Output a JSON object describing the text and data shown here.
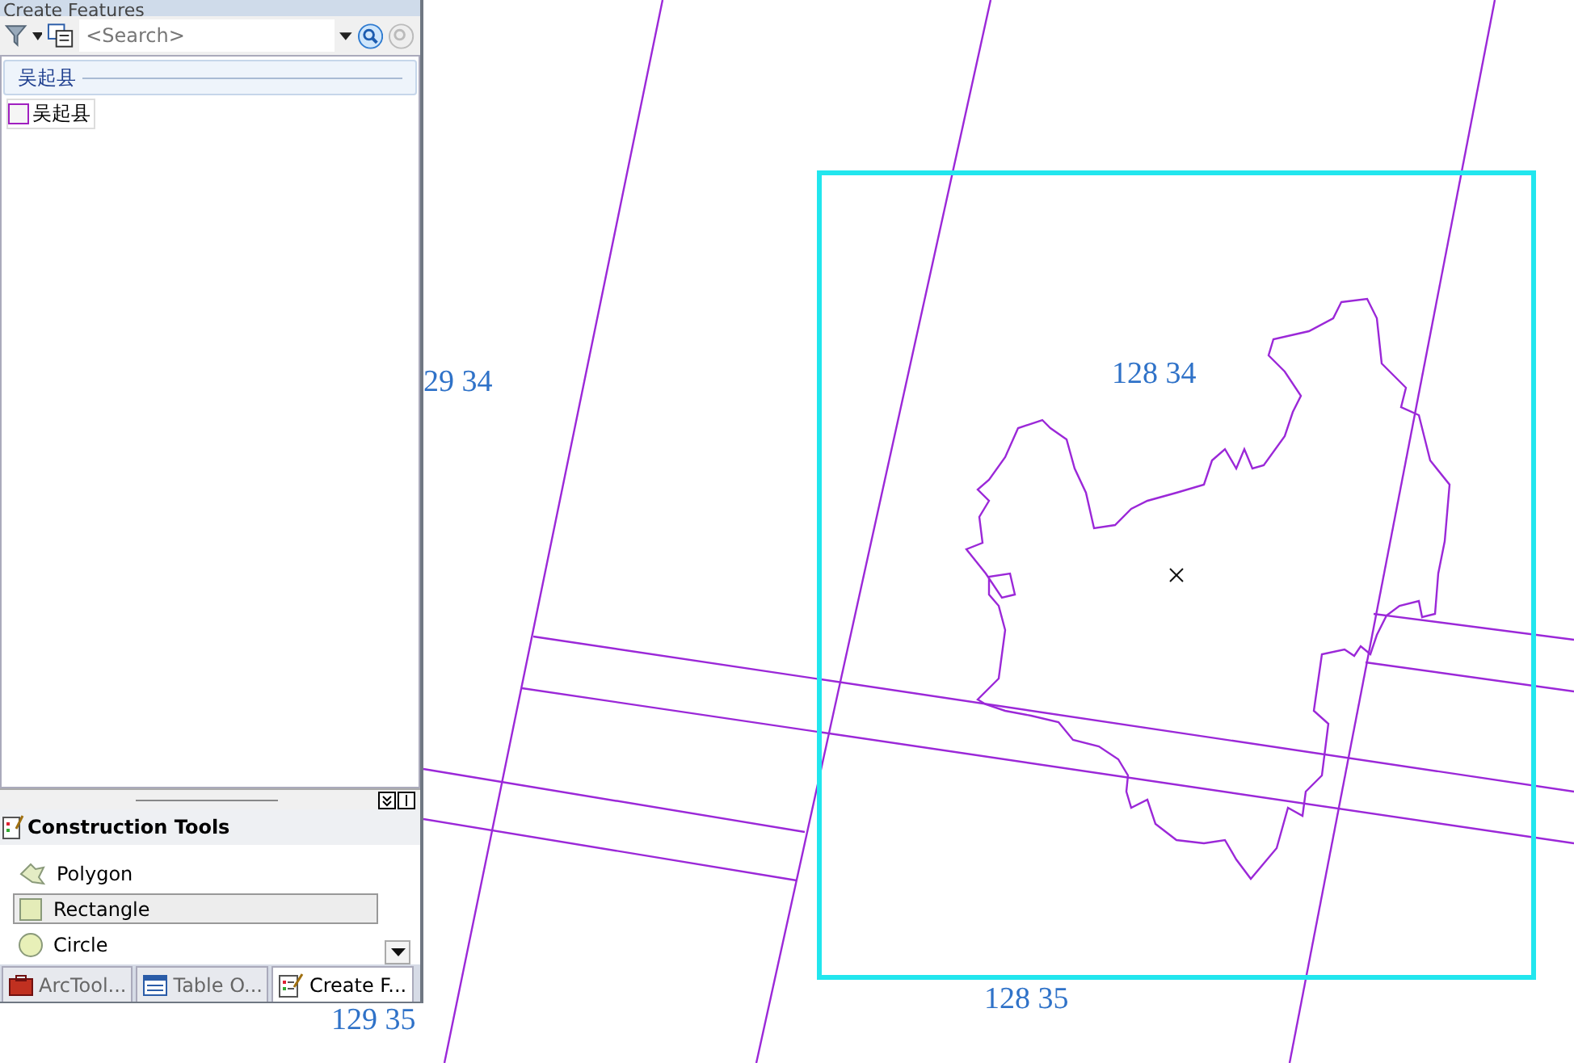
{
  "panel": {
    "title": "Create Features",
    "search": {
      "placeholder": "<Search>"
    },
    "templates": [
      {
        "group": "吴起县",
        "items": [
          {
            "label": "吴起县"
          }
        ]
      }
    ],
    "construction_tools": {
      "title": "Construction Tools",
      "tools": [
        {
          "label": "Polygon",
          "kind": "polygon",
          "selected": false
        },
        {
          "label": "Rectangle",
          "kind": "rectangle",
          "selected": true
        },
        {
          "label": "Circle",
          "kind": "circle",
          "selected": false
        }
      ]
    },
    "tabs": [
      {
        "label": "ArcTool...",
        "kind": "toolbox",
        "selected": false
      },
      {
        "label": "Table O...",
        "kind": "table",
        "selected": false
      },
      {
        "label": "Create F...",
        "kind": "create",
        "selected": true
      }
    ]
  },
  "map": {
    "labels": [
      {
        "text": "29 34"
      },
      {
        "text": "128 34"
      },
      {
        "text": "128 35"
      },
      {
        "text": "129 35"
      }
    ]
  }
}
